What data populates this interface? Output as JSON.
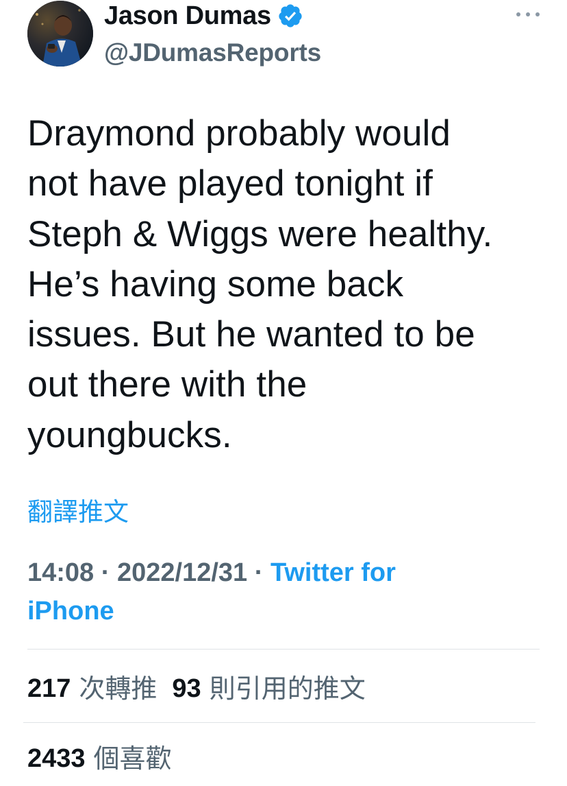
{
  "author": {
    "display_name": "Jason Dumas",
    "handle": "@JDumasReports",
    "verified": true
  },
  "tweet": {
    "text": "Draymond probably would\nnot have played tonight if\nSteph & Wiggs were healthy.\nHe’s having some back\nissues. But he wanted to be\nout there with the\nyoungbucks.",
    "translate_label": "翻譯推文",
    "time": "14:08",
    "separator": " · ",
    "date": "2022/12/31",
    "source_line1": "Twitter for",
    "source_line2": "iPhone"
  },
  "stats": {
    "retweets_count": "217",
    "retweets_label": "次轉推",
    "quotes_count": "93",
    "quotes_label": "則引用的推文",
    "likes_count": "2433",
    "likes_label": "個喜歡"
  },
  "icons": {
    "verified": "verified-badge-icon",
    "more": "more-options-icon"
  },
  "colors": {
    "text_primary": "#0f1419",
    "text_secondary": "#536471",
    "link_blue": "#1d9bf0",
    "divider": "#dfe3e6"
  }
}
